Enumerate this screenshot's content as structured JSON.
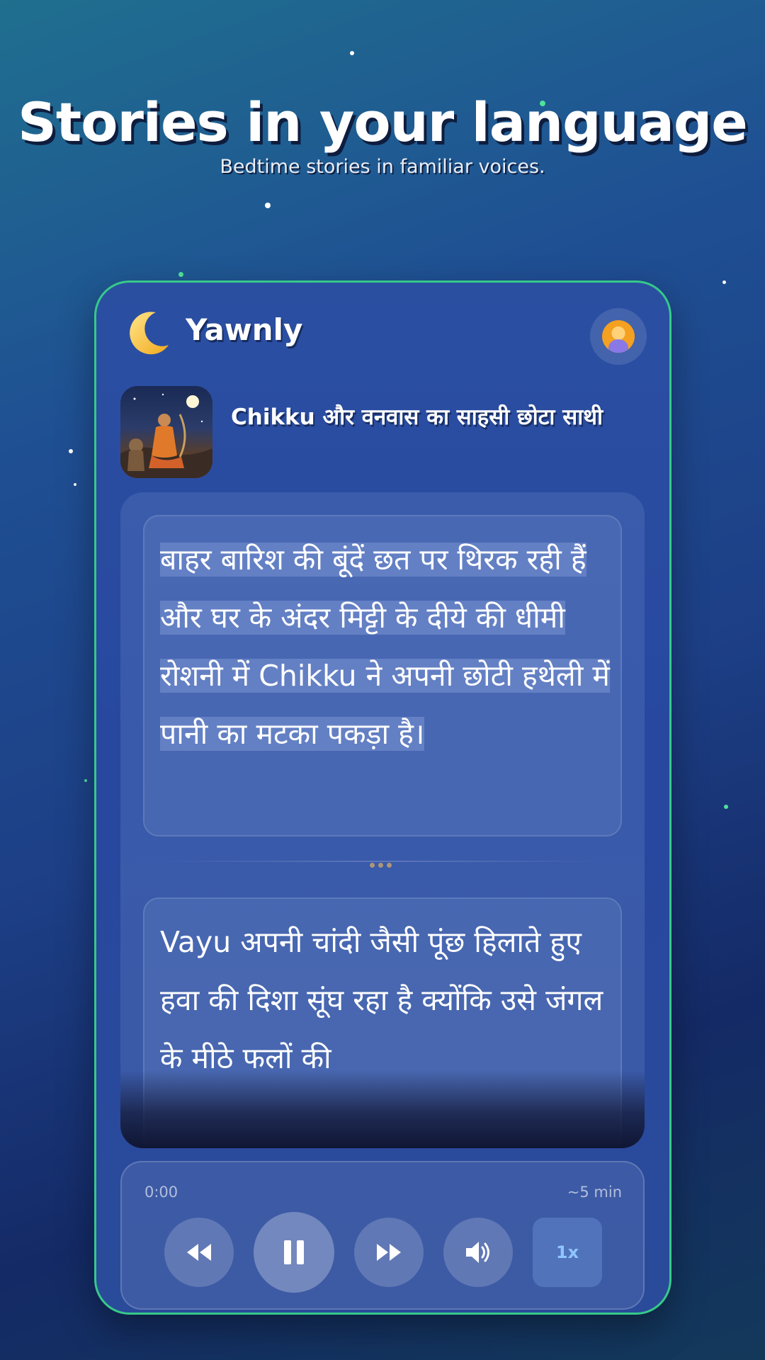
{
  "promo": {
    "headline": "Stories in your language",
    "subheadline": "Bedtime stories in familiar voices."
  },
  "app": {
    "name": "Yawnly",
    "logo_icon": "moon-icon",
    "profile_icon": "avatar-icon"
  },
  "story": {
    "title": "Chikku और वनवास का साहसी छोटा साथी",
    "paragraphs": [
      "बाहर बारिश की बूंदें छत पर थिरक रही हैं और घर के अंदर मिट्टी के दीये की धीमी रोशनी में Chikku ने अपनी छोटी हथेली में पानी का मटका पकड़ा है।",
      "Vayu अपनी चांदी जैसी पूंछ हिलाते हुए हवा की दिशा सूंघ रहा है क्योंकि उसे जंगल के मीठे फलों की"
    ]
  },
  "player": {
    "elapsed": "0:00",
    "duration": "~5 min",
    "speed": "1x",
    "controls": [
      "rewind-icon",
      "pause-icon",
      "fast-forward-icon",
      "volume-icon"
    ]
  },
  "colors": {
    "phone_border": "#36c98a",
    "speed_label": "#8fc6ff",
    "avatar": "#f4a020"
  }
}
